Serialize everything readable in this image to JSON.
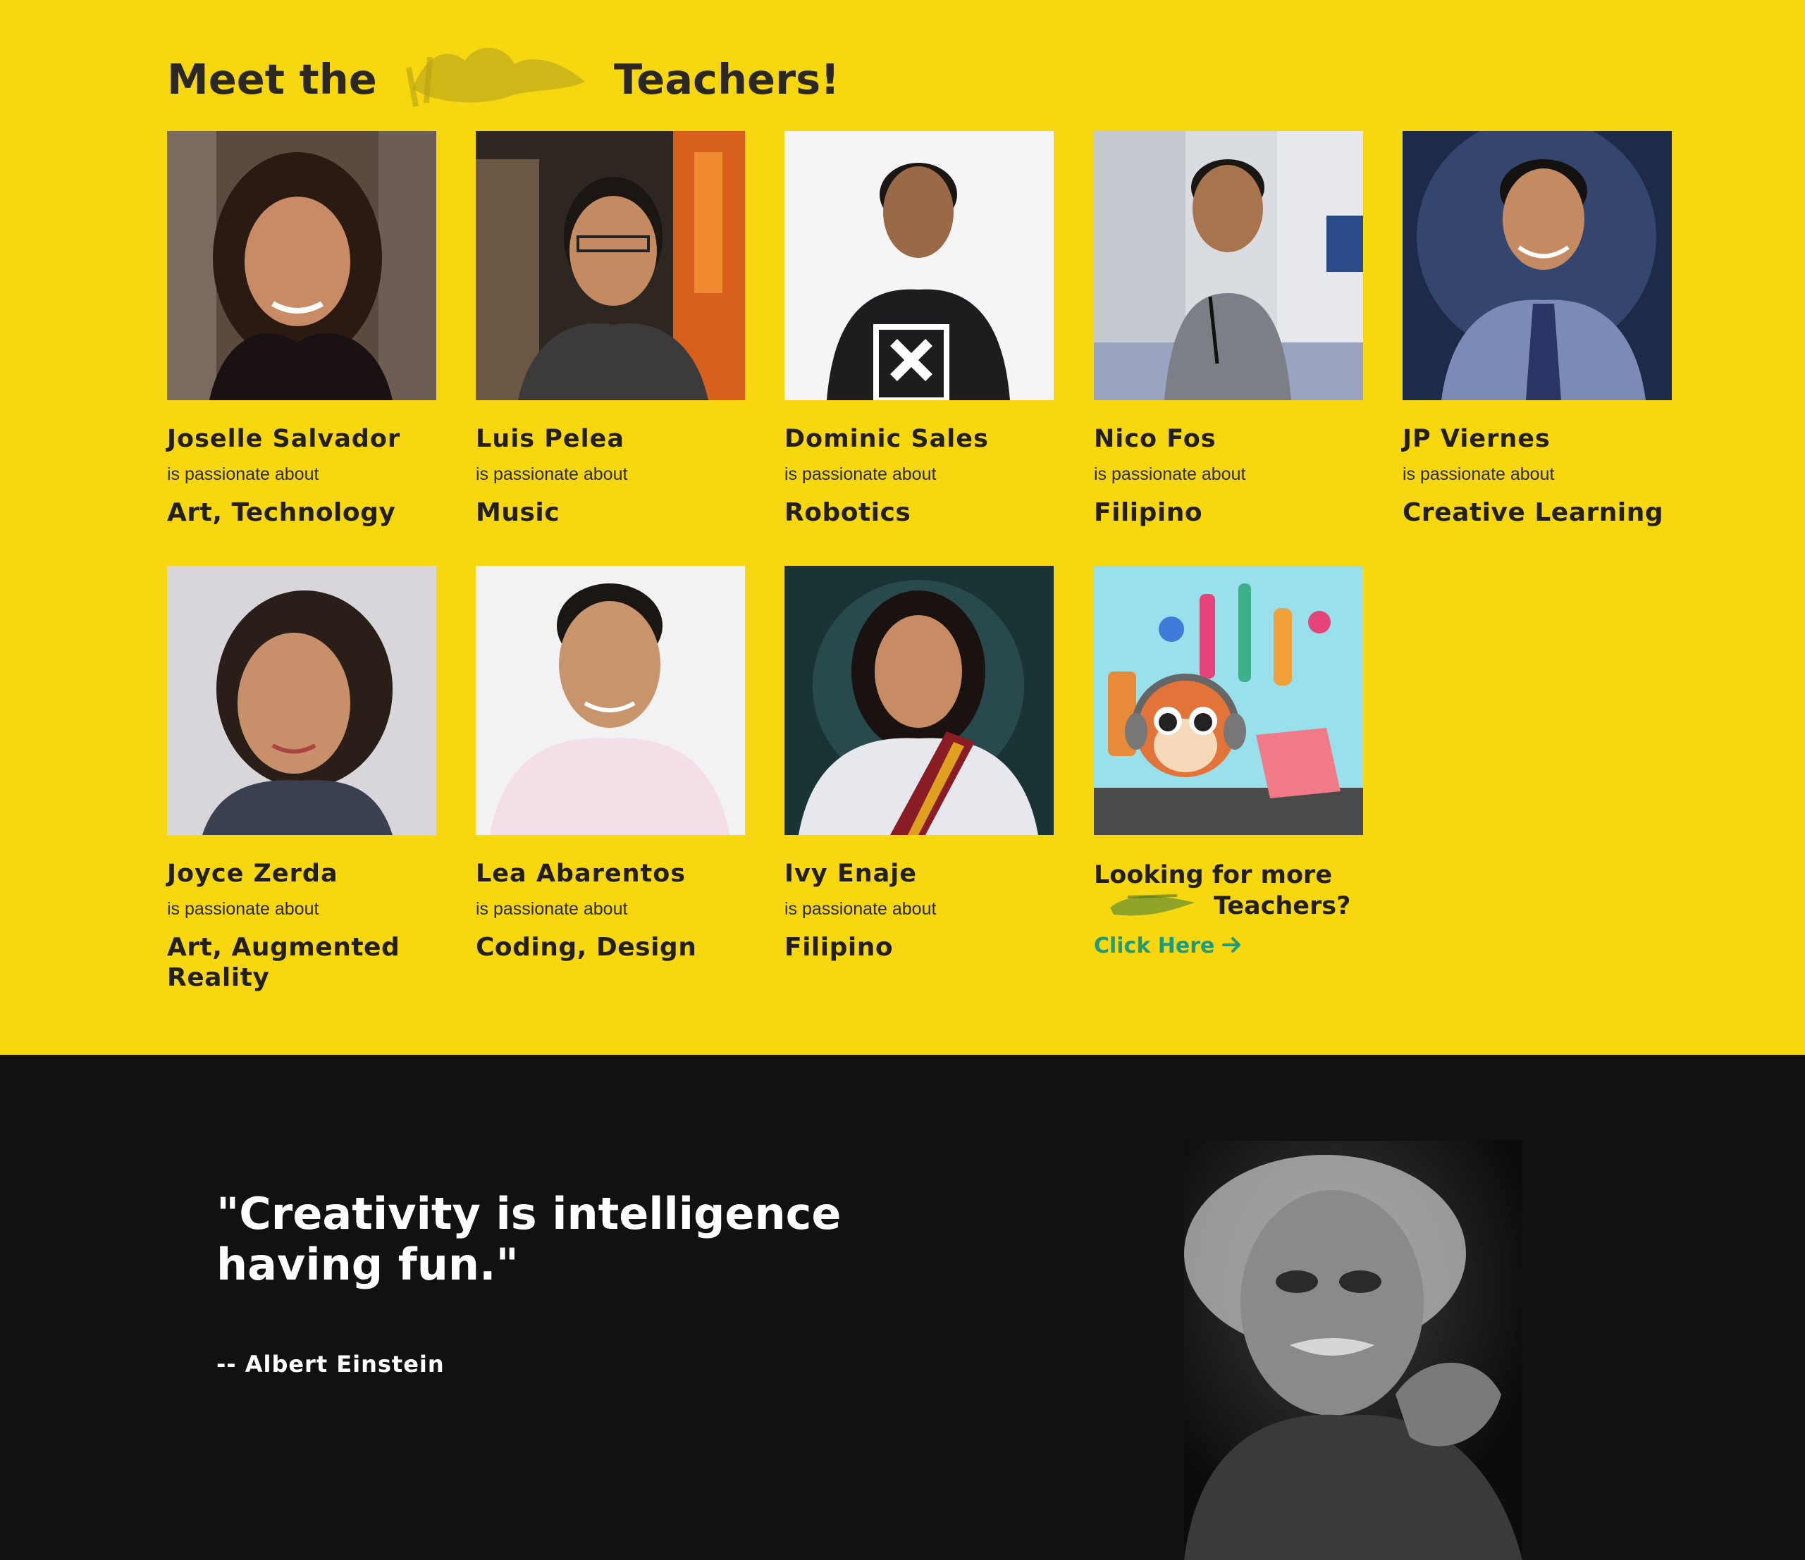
{
  "heading": {
    "before": "Meet the",
    "after": "Teachers!"
  },
  "intro_text": "is passionate about",
  "teachers": [
    {
      "name": "Joselle Salvador",
      "topic": "Art, Technology"
    },
    {
      "name": "Luis Pelea",
      "topic": "Music"
    },
    {
      "name": "Dominic Sales",
      "topic": "Robotics"
    },
    {
      "name": "Nico Fos",
      "topic": "Filipino"
    },
    {
      "name": "JP Viernes",
      "topic": "Creative Learning"
    },
    {
      "name": "Joyce Zerda",
      "topic": "Art, Augmented Reality"
    },
    {
      "name": "Lea Abarentos",
      "topic": "Coding, Design"
    },
    {
      "name": "Ivy Enaje",
      "topic": "Filipino"
    }
  ],
  "more": {
    "line1": "Looking for more",
    "line2": "Teachers?",
    "link_label": "Click Here",
    "link_icon": "arrow-right-icon"
  },
  "quote": {
    "text": "\"Creativity is intelligence having fun.\"",
    "author": "-- Albert Einstein"
  },
  "colors": {
    "section_bg": "#f7d70f",
    "dark_bg": "#111111",
    "link": "#1f9a7a",
    "heading": "#2b2824"
  }
}
